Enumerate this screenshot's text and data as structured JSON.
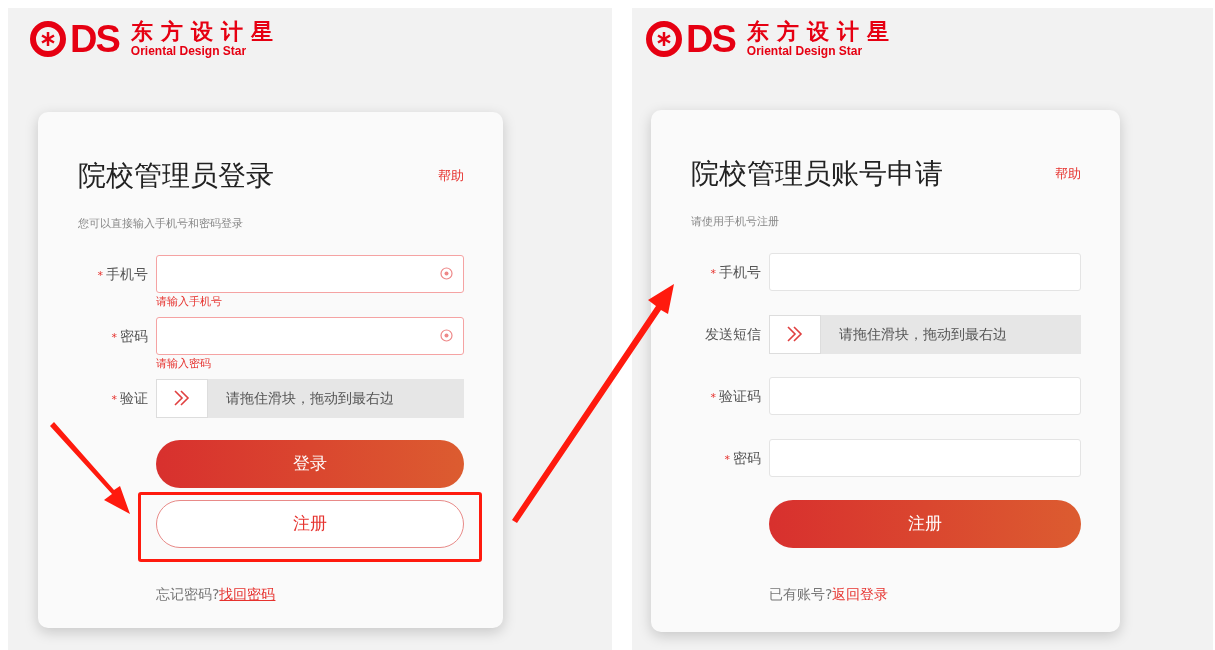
{
  "panels": [
    {
      "logo": {
        "mark": "DS",
        "cn": "东方设计星",
        "en": "Oriental Design Star"
      },
      "title": "院校管理员登录",
      "help": "帮助",
      "subtitle": "您可以直接输入手机号和密码登录",
      "fields": [
        {
          "kind": "input",
          "marker": "*",
          "label": "手机号",
          "invalid": true,
          "error": "请输入手机号"
        },
        {
          "kind": "input",
          "marker": "*",
          "label": "密码",
          "invalid": true,
          "error": "请输入密码"
        },
        {
          "kind": "slider",
          "marker": "*",
          "label": "验证",
          "hint": "请拖住滑块，拖动到最右边"
        }
      ],
      "buttons": [
        {
          "kind": "primary",
          "label": "登录",
          "highlighted": false
        },
        {
          "kind": "outline",
          "label": "注册",
          "highlighted": true
        }
      ],
      "footer": {
        "text": "忘记密码?",
        "link": "找回密码",
        "underlined": true
      }
    },
    {
      "logo": {
        "mark": "DS",
        "cn": "东方设计星",
        "en": "Oriental Design Star"
      },
      "title": "院校管理员账号申请",
      "help": "帮助",
      "subtitle": "请使用手机号注册",
      "fields": [
        {
          "kind": "input",
          "marker": "*",
          "label": "手机号",
          "invalid": false
        },
        {
          "kind": "slider",
          "label": "发送短信",
          "hint": "请拖住滑块，拖动到最右边"
        },
        {
          "kind": "input",
          "marker": "*",
          "label": "验证码",
          "invalid": false
        },
        {
          "kind": "input",
          "marker": "*",
          "label": "密码",
          "invalid": false
        }
      ],
      "buttons": [
        {
          "kind": "primary",
          "label": "注册",
          "highlighted": false
        }
      ],
      "footer": {
        "text": "已有账号?",
        "link": "返回登录",
        "underlined": false
      }
    }
  ]
}
